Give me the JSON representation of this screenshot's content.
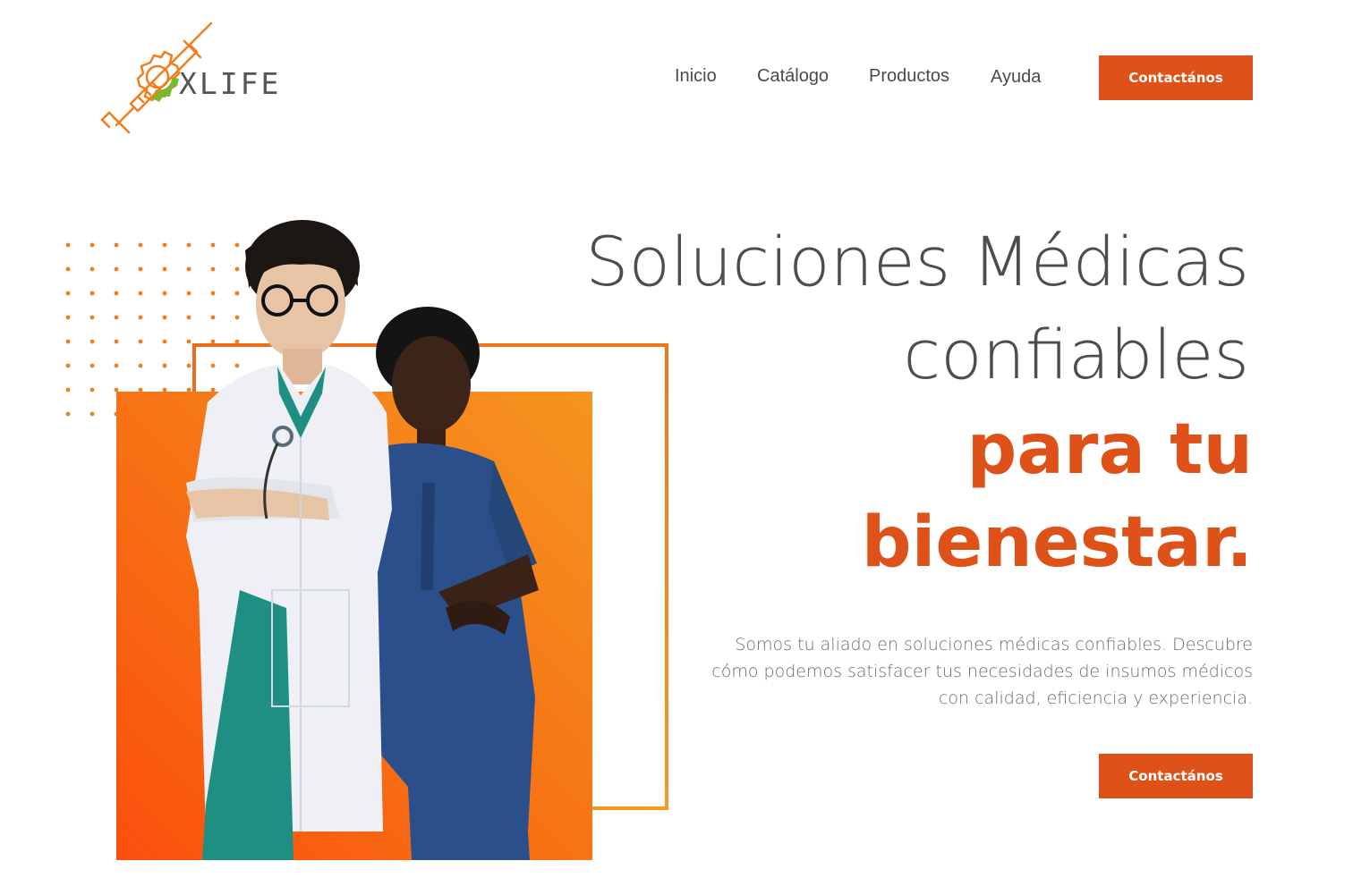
{
  "brand": {
    "name": "XLIFE",
    "accent": "#de5219",
    "logo_green": "#7cb82f",
    "logo_orange": "#f07e1c"
  },
  "nav": {
    "items": [
      {
        "label": "Inicio"
      },
      {
        "label": "Catálogo"
      },
      {
        "label": "Productos"
      },
      {
        "label": "Ayuda"
      }
    ],
    "cta_label": "Contactános"
  },
  "hero": {
    "title_line1": "Soluciones Médicas",
    "title_line2": "confiables",
    "title_line3": "para tu",
    "title_line4": "bienestar.",
    "description": "Somos tu aliado en soluciones médicas confiables. Descubre cómo podemos satisfacer tus necesidades de insumos médicos con calidad, eficiencia y experiencia.",
    "cta_label": "Contactános",
    "image_icon": "medical-staff-photo"
  }
}
